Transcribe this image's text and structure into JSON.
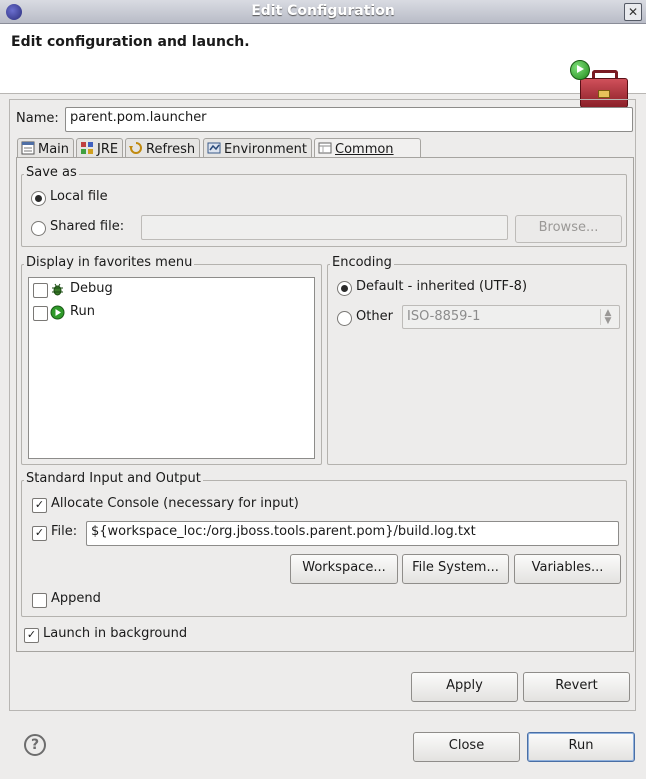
{
  "window": {
    "title": "Edit Configuration",
    "close_glyph": "✕"
  },
  "banner": {
    "heading": "Edit configuration and launch."
  },
  "name_field": {
    "label": "Name:",
    "value": "parent.pom.launcher"
  },
  "tabs": [
    {
      "label": "Main",
      "icon": "main-tab-icon"
    },
    {
      "label": "JRE",
      "icon": "jre-tab-icon"
    },
    {
      "label": "Refresh",
      "icon": "refresh-tab-icon"
    },
    {
      "label": "Environment",
      "icon": "environment-tab-icon"
    },
    {
      "label": "Common",
      "icon": "common-tab-icon",
      "active": true
    }
  ],
  "save_as": {
    "title": "Save as",
    "local_label": "Local file",
    "shared_label": "Shared file:",
    "shared_value": "",
    "browse_label": "Browse..."
  },
  "favorites": {
    "title": "Display in favorites menu",
    "items": [
      {
        "label": "Debug",
        "icon": "debug-icon",
        "checked": false
      },
      {
        "label": "Run",
        "icon": "run-icon",
        "checked": false
      }
    ]
  },
  "encoding": {
    "title": "Encoding",
    "default_label": "Default - inherited (UTF-8)",
    "other_label": "Other",
    "other_value": "ISO-8859-1"
  },
  "std_io": {
    "title": "Standard Input and Output",
    "allocate_label": "Allocate Console (necessary for input)",
    "file_label": "File:",
    "file_value": "${workspace_loc:/org.jboss.tools.parent.pom}/build.log.txt",
    "workspace_btn": "Workspace...",
    "filesystem_btn": "File System...",
    "variables_btn": "Variables...",
    "append_label": "Append"
  },
  "launch_bg_label": "Launch in background",
  "buttons": {
    "apply": "Apply",
    "revert": "Revert",
    "close": "Close",
    "run": "Run"
  },
  "help_glyph": "?"
}
